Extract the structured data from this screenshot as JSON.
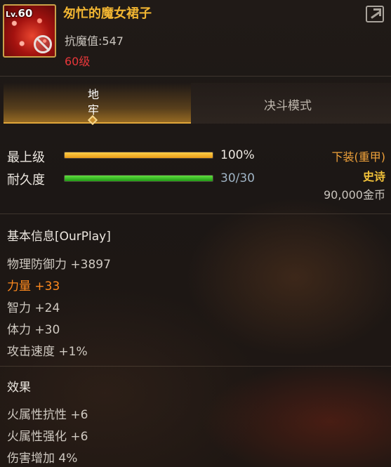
{
  "item": {
    "level_prefix": "Lv.",
    "level": "60",
    "name": "匆忙的魔女裙子",
    "anti_magic": "抗魔值:547",
    "required_level": "60级"
  },
  "tabs": [
    {
      "label": "地牢",
      "active": true
    },
    {
      "label": "决斗模式",
      "active": false
    }
  ],
  "bars": {
    "upgrade": {
      "label": "最上级",
      "value_text": "100%",
      "fraction": 1.0
    },
    "durability": {
      "label": "耐久度",
      "value_text": "30/30",
      "fraction": 1.0
    }
  },
  "right_info": {
    "slot": "下装(重甲)",
    "rarity": "史诗",
    "price": "90,000金币"
  },
  "basic_info": {
    "title": "基本信息[OurPlay]",
    "stats": [
      {
        "text": "物理防御力 +3897",
        "highlight": false
      },
      {
        "text": "力量 +33",
        "highlight": true
      },
      {
        "text": "智力 +24",
        "highlight": false
      },
      {
        "text": "体力 +30",
        "highlight": false
      },
      {
        "text": "攻击速度 +1%",
        "highlight": false
      }
    ]
  },
  "effects": {
    "title": "效果",
    "stats": [
      {
        "text": "火属性抗性 +6"
      },
      {
        "text": "火属性强化 +6"
      },
      {
        "text": "伤害增加 4%"
      }
    ]
  },
  "colors": {
    "name": "#f2b632",
    "required_level": "#e8373a",
    "highlight_stat": "#ff8a1e",
    "slot_text": "#f0a23a",
    "rarity_text": "#f2c23a",
    "tab_accent": "#e0a63a"
  },
  "icons": [
    "item-icon",
    "no-trade-icon",
    "share-icon",
    "tab-diamond-icon"
  ]
}
